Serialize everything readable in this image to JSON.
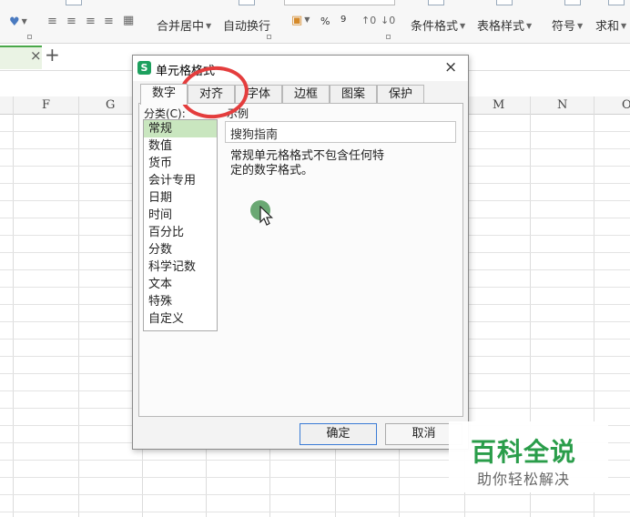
{
  "ribbon": {
    "merge_center": "合并居中",
    "auto_wrap": "自动换行",
    "percent": "%",
    "comma": "9",
    "conditional_format": "条件格式",
    "table_style": "表格样式",
    "symbol": "符号",
    "sum": "求和"
  },
  "sheet_tabs": {
    "close_symbol": "×",
    "add_symbol": "+"
  },
  "columns": [
    "F",
    "G",
    "M",
    "N",
    "O"
  ],
  "dialog": {
    "title": "单元格格式",
    "close_symbol": "×",
    "app_icon_letter": "S",
    "tabs": [
      "数字",
      "对齐",
      "字体",
      "边框",
      "图案",
      "保护"
    ],
    "active_tab_index": 0,
    "category_label": "分类(C):",
    "categories": [
      "常规",
      "数值",
      "货币",
      "会计专用",
      "日期",
      "时间",
      "百分比",
      "分数",
      "科学记数",
      "文本",
      "特殊",
      "自定义"
    ],
    "selected_category_index": 0,
    "sample_label": "示例",
    "sample_value": "搜狗指南",
    "description": "常规单元格格式不包含任何特定的数字格式。",
    "ok_label": "确定",
    "cancel_label": "取消"
  },
  "watermark": {
    "title": "百科全说",
    "subtitle": "助你轻松解决"
  },
  "colors": {
    "accent_green": "#2a9d4a",
    "selection_green": "#c9e6bf",
    "annotation_red": "#e43d3d"
  }
}
